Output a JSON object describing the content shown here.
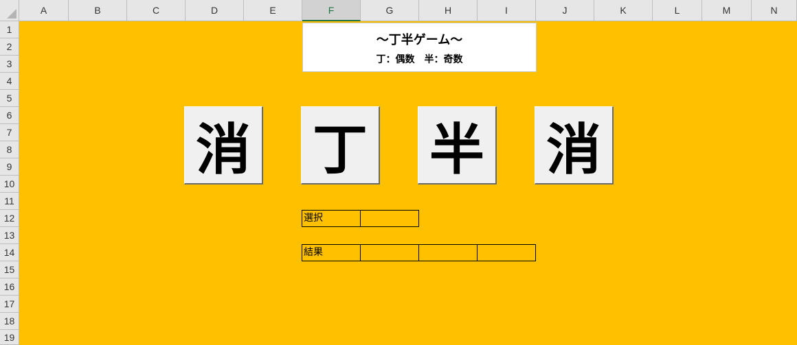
{
  "sheet": {
    "columns": [
      "A",
      "B",
      "C",
      "D",
      "E",
      "F",
      "G",
      "H",
      "I",
      "J",
      "K",
      "L",
      "M",
      "N"
    ],
    "selected_column": "F",
    "rows": [
      "1",
      "2",
      "3",
      "4",
      "5",
      "6",
      "7",
      "8",
      "9",
      "10",
      "11",
      "12",
      "13",
      "14",
      "15",
      "16",
      "17",
      "18",
      "19"
    ]
  },
  "title_box": {
    "title": "〜丁半ゲーム〜",
    "subtitle": "丁：偶数　半：奇数"
  },
  "buttons": [
    {
      "label": "消"
    },
    {
      "label": "丁"
    },
    {
      "label": "半"
    },
    {
      "label": "消"
    }
  ],
  "selection_row": {
    "label": "選択",
    "value": ""
  },
  "result_row": {
    "label": "結果",
    "values": [
      "",
      "",
      ""
    ]
  }
}
